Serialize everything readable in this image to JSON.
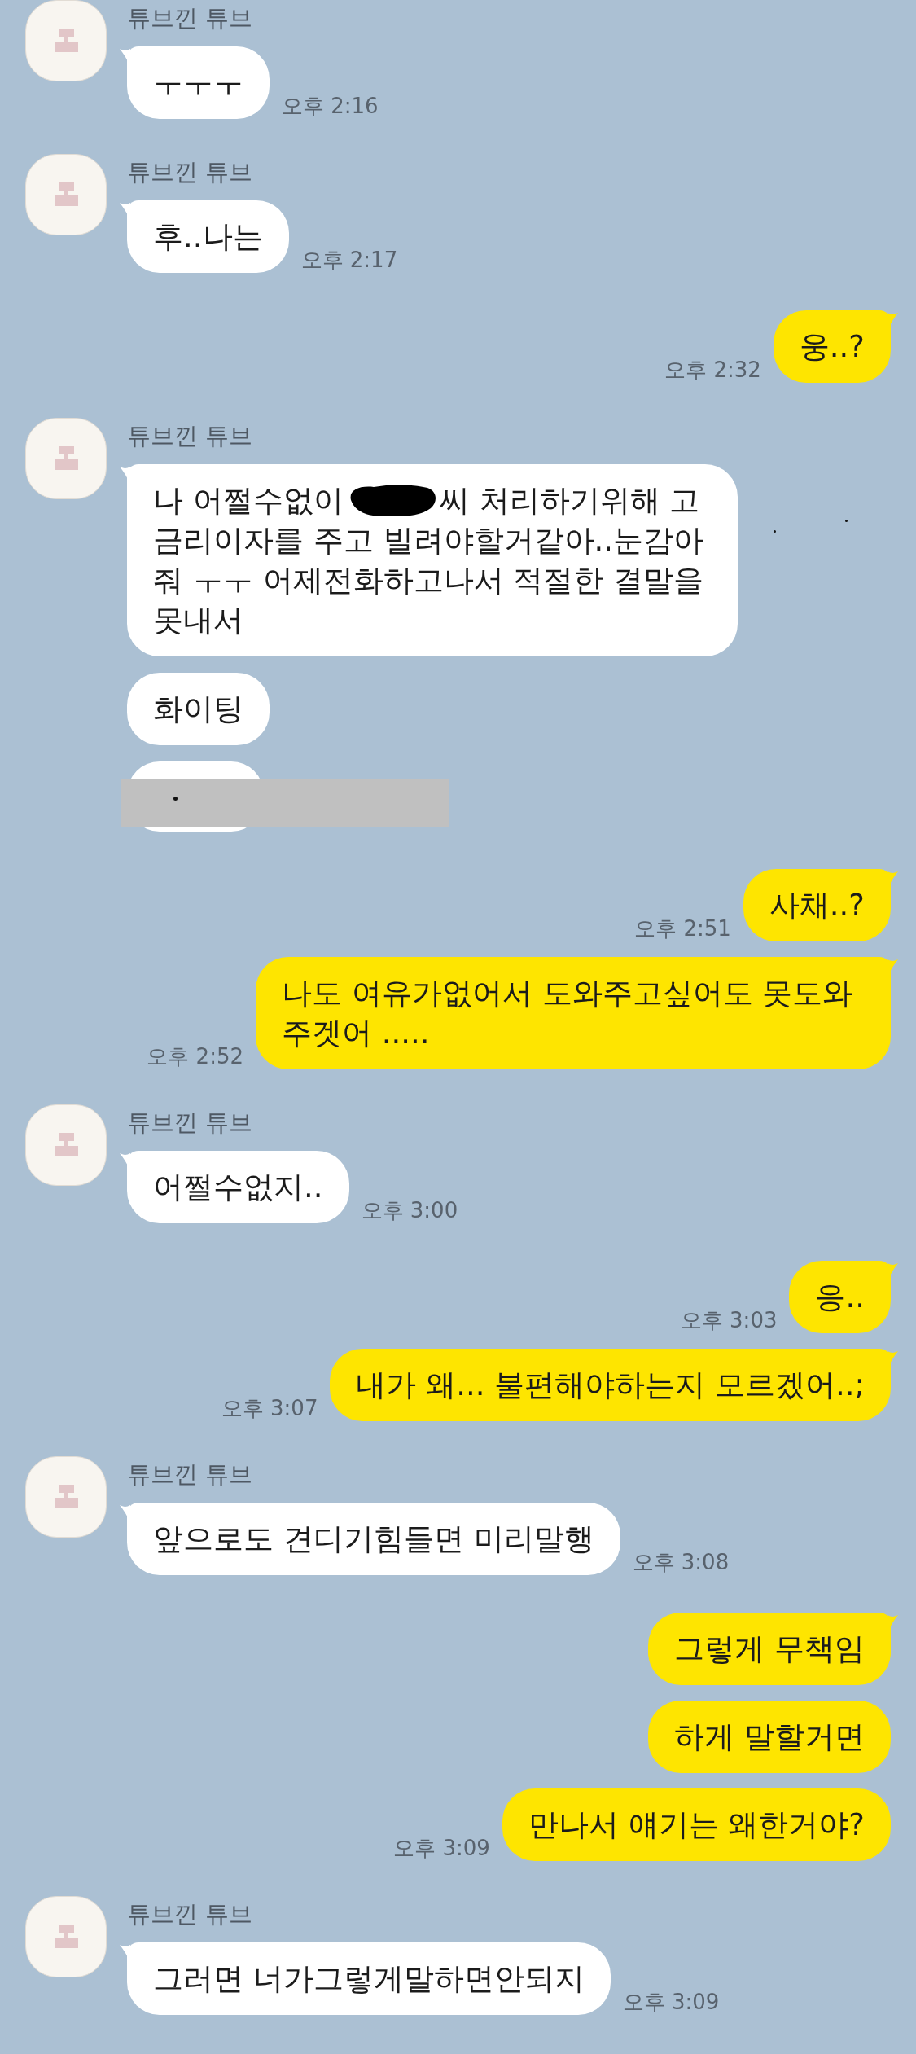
{
  "chat": {
    "groups": [
      {
        "kind": "received",
        "sender": "튜브낀 튜브",
        "time": "오후 2:16",
        "bubbles": [
          {
            "kind": "text",
            "text": "ㅜㅜㅜ",
            "tail": true
          }
        ]
      },
      {
        "kind": "received",
        "sender": "튜브낀 튜브",
        "time": "오후 2:17",
        "bubbles": [
          {
            "kind": "text",
            "text": "후..나는",
            "tail": true
          }
        ]
      },
      {
        "kind": "sent",
        "time": "오후 2:32",
        "bubbles": [
          {
            "kind": "text",
            "text": "웅..?",
            "tail": true
          }
        ]
      },
      {
        "kind": "received",
        "sender": "튜브낀 튜브",
        "bubbles": [
          {
            "kind": "redacted",
            "tail": true,
            "first_line": [
              {
                "kind": "text",
                "text": "나 어쩔수없이"
              },
              {
                "kind": "blot"
              },
              {
                "kind": "text",
                "text": "씨 처리하기위해 고"
              }
            ],
            "text": "금리이자를 주고 빌려야할거같아..눈감아 줘 ㅜㅜ 어제전화하고나서 적절한 결말을 못내서"
          },
          {
            "kind": "text",
            "text": "화이팅",
            "tail": false
          },
          {
            "kind": "covered",
            "tail": false
          }
        ]
      },
      {
        "kind": "sent",
        "time": "오후 2:51",
        "bubbles": [
          {
            "kind": "text",
            "text": "사채..?",
            "tail": true
          }
        ]
      },
      {
        "kind": "sent",
        "time": "오후 2:52",
        "bubbles": [
          {
            "kind": "text",
            "text": "나도 여유가없어서 도와주고싶어도 못도와 주겟어 .....",
            "tail": true
          }
        ]
      },
      {
        "kind": "received",
        "sender": "튜브낀 튜브",
        "time": "오후 3:00",
        "bubbles": [
          {
            "kind": "text",
            "text": "어쩔수없지..",
            "tail": true
          }
        ]
      },
      {
        "kind": "sent",
        "time": "오후 3:03",
        "bubbles": [
          {
            "kind": "text",
            "text": "응..",
            "tail": true
          }
        ]
      },
      {
        "kind": "sent",
        "time": "오후 3:07",
        "bubbles": [
          {
            "kind": "text",
            "text": "내가 왜... 불편해야하는지 모르겠어..;",
            "tail": true
          }
        ]
      },
      {
        "kind": "received",
        "sender": "튜브낀 튜브",
        "time": "오후 3:08",
        "bubbles": [
          {
            "kind": "text",
            "text": "앞으로도 견디기힘들면 미리말행",
            "tail": true
          }
        ]
      },
      {
        "kind": "sent",
        "time": "오후 3:09",
        "bubbles": [
          {
            "kind": "text",
            "text": "그렇게 무책임",
            "tail": true
          },
          {
            "kind": "text",
            "text": "하게 말할거면",
            "tail": false
          },
          {
            "kind": "text",
            "text": "만나서 얘기는 왜한거야?",
            "tail": false
          }
        ]
      },
      {
        "kind": "received",
        "sender": "튜브낀 튜브",
        "time": "오후 3:09",
        "bubbles": [
          {
            "kind": "text",
            "text": "그러면 너가그렇게말하면안되지",
            "tail": true
          }
        ]
      }
    ]
  }
}
